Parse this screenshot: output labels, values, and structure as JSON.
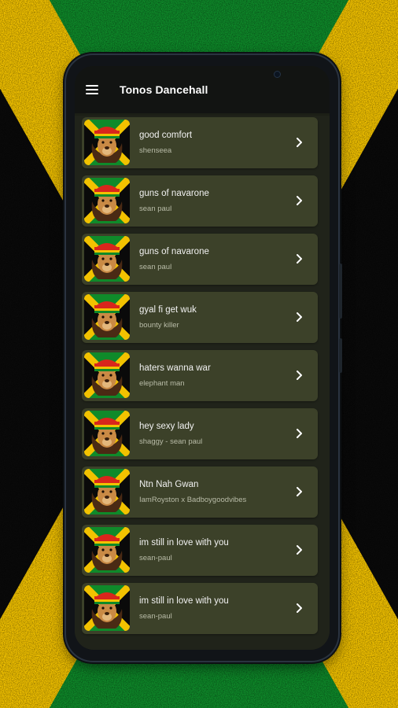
{
  "app": {
    "title": "Tonos Dancehall"
  },
  "colors": {
    "flag_green": "#0f8a2a",
    "flag_yellow": "#f2c200",
    "flag_black": "#0a0a0a",
    "card": "#3c4129"
  },
  "icons": {
    "menu": "hamburger-menu-icon",
    "chevron": "chevron-right-icon",
    "thumbnail": "rasta-lion-icon"
  },
  "songs": [
    {
      "title": "good comfort",
      "artist": "shenseea"
    },
    {
      "title": "guns of navarone",
      "artist": "sean paul"
    },
    {
      "title": "guns of navarone",
      "artist": "sean paul"
    },
    {
      "title": "gyal fi get wuk",
      "artist": "bounty killer"
    },
    {
      "title": "haters wanna war",
      "artist": "elephant man"
    },
    {
      "title": "hey sexy lady",
      "artist": "shaggy - sean paul"
    },
    {
      "title": "Ntn Nah Gwan",
      "artist": "IamRoyston x Badboygoodvibes"
    },
    {
      "title": "im still in love with you",
      "artist": "sean-paul"
    },
    {
      "title": "im still in love with you",
      "artist": "sean-paul"
    }
  ]
}
